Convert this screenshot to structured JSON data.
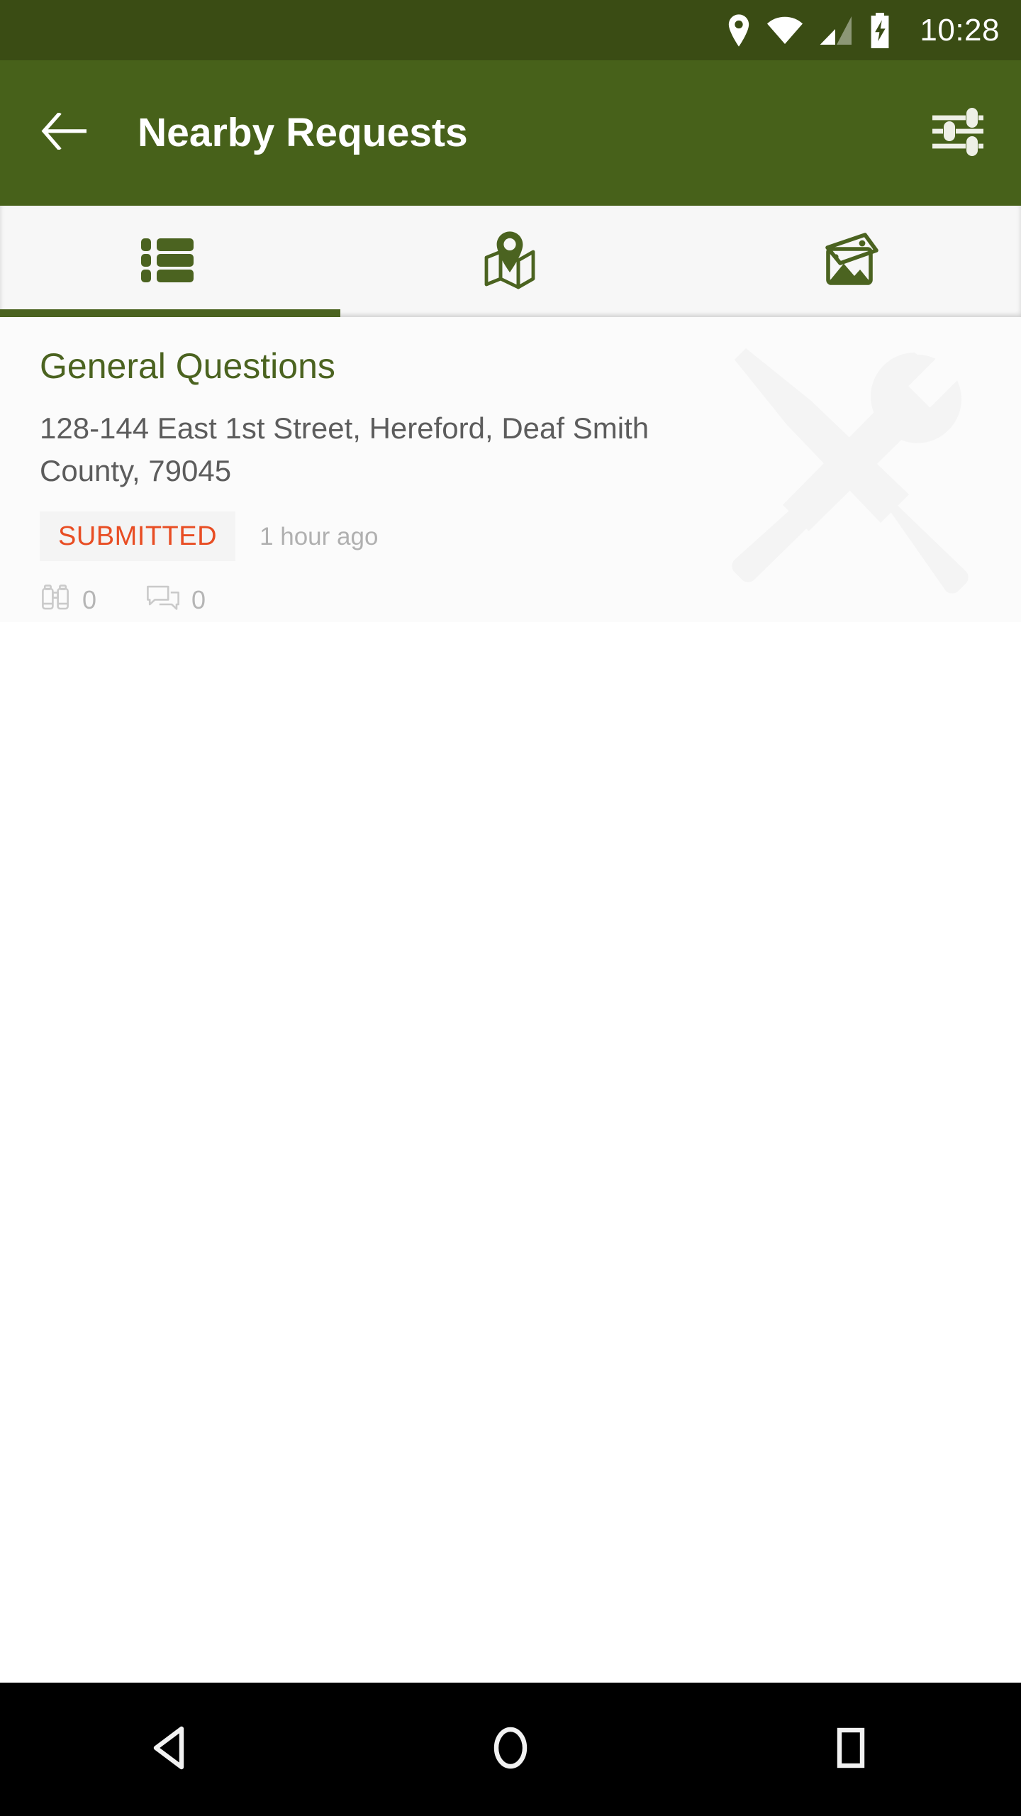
{
  "status_bar": {
    "time": "10:28",
    "icons": [
      "location-icon",
      "wifi-icon",
      "cellular-signal-icon",
      "battery-charging-icon"
    ],
    "background_color": "#3A4C14",
    "foreground_color": "#FFFFFF"
  },
  "app_bar": {
    "title": "Nearby Requests",
    "back_icon": "arrow-left-icon",
    "filter_icon": "filter-sliders-icon",
    "background_color": "#47611A",
    "text_color": "#FFFFFF"
  },
  "tabs": {
    "active_index": 0,
    "accent_color": "#4B6320",
    "background_color": "#F7F7F7",
    "items": [
      {
        "name": "list",
        "icon": "list-view-icon",
        "active": true
      },
      {
        "name": "map",
        "icon": "map-pin-icon",
        "active": false
      },
      {
        "name": "photos",
        "icon": "photo-gallery-icon",
        "active": false
      }
    ]
  },
  "requests": [
    {
      "title": "General Questions",
      "address": "128-144  East 1st Street, Hereford, Deaf Smith County, 79045",
      "status": "SUBMITTED",
      "status_color": "#E84D23",
      "status_background": "#F4F4F4",
      "timestamp": "1 hour ago",
      "watch_icon": "binoculars-icon",
      "watch_count": "0",
      "comment_icon": "comment-bubbles-icon",
      "comment_count": "0",
      "watermark_icon": "tools-wrench-screwdriver-icon"
    }
  ],
  "nav_bar": {
    "background_color": "#000000",
    "buttons": [
      {
        "name": "back",
        "icon": "nav-back-triangle-icon"
      },
      {
        "name": "home",
        "icon": "nav-home-circle-icon"
      },
      {
        "name": "recents",
        "icon": "nav-recents-square-icon"
      }
    ]
  }
}
